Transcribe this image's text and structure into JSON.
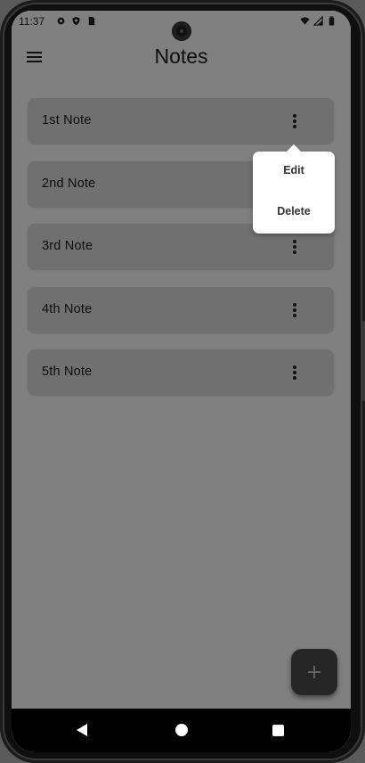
{
  "status_bar": {
    "time": "11:37",
    "left_icons": [
      "gear-icon",
      "shield-icon",
      "sim-card-icon"
    ],
    "right_icons": [
      "wifi-icon",
      "signal-icon",
      "battery-icon"
    ]
  },
  "app_bar": {
    "title": "Notes",
    "menu_icon": "hamburger-menu-icon"
  },
  "notes": [
    {
      "title": "1st Note"
    },
    {
      "title": "2nd Note"
    },
    {
      "title": "3rd Note"
    },
    {
      "title": "4th Note"
    },
    {
      "title": "5th Note"
    }
  ],
  "popup_menu": {
    "anchor_note": "1st Note",
    "items": [
      {
        "label": "Edit"
      },
      {
        "label": "Delete"
      }
    ]
  },
  "fab": {
    "icon": "plus-icon"
  },
  "nav_bar": {
    "icons": [
      "back-icon",
      "home-icon",
      "recents-icon"
    ]
  },
  "colors": {
    "card": "#d6d6d6",
    "fab": "#4a4a4a",
    "popup": "#ffffff",
    "scrim": "rgba(0,0,0,0.48)"
  }
}
